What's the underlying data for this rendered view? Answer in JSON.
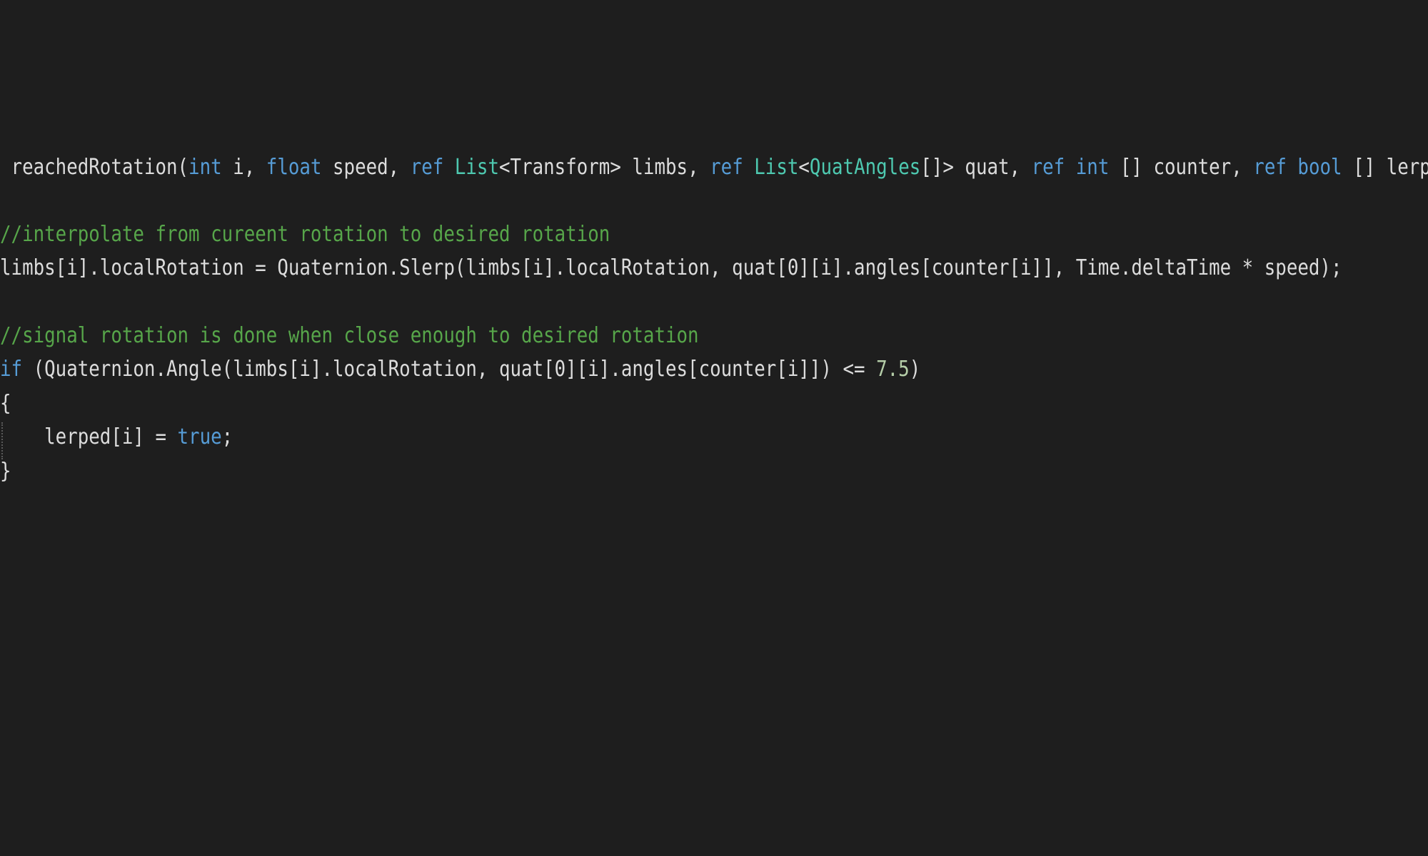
{
  "colors": {
    "background": "#1e1e1e",
    "plain": "#dcdcdc",
    "keyword": "#569cd6",
    "type": "#4ec9b0",
    "comment": "#57a64a",
    "number": "#b5cea8"
  },
  "editor": {
    "lines": [
      {
        "tokens": [
          {
            "text": " reachedRotation(",
            "kind": "plain"
          },
          {
            "text": "int",
            "kind": "keyword"
          },
          {
            "text": " i, ",
            "kind": "plain"
          },
          {
            "text": "float",
            "kind": "keyword"
          },
          {
            "text": " speed, ",
            "kind": "plain"
          },
          {
            "text": "ref",
            "kind": "keyword"
          },
          {
            "text": " ",
            "kind": "plain"
          },
          {
            "text": "List",
            "kind": "type"
          },
          {
            "text": "<Transform> limbs, ",
            "kind": "plain"
          },
          {
            "text": "ref",
            "kind": "keyword"
          },
          {
            "text": " ",
            "kind": "plain"
          },
          {
            "text": "List",
            "kind": "type"
          },
          {
            "text": "<",
            "kind": "plain"
          },
          {
            "text": "QuatAngles",
            "kind": "type"
          },
          {
            "text": "[]> quat, ",
            "kind": "plain"
          },
          {
            "text": "ref",
            "kind": "keyword"
          },
          {
            "text": " ",
            "kind": "plain"
          },
          {
            "text": "int",
            "kind": "keyword"
          },
          {
            "text": " [] counter, ",
            "kind": "plain"
          },
          {
            "text": "ref",
            "kind": "keyword"
          },
          {
            "text": " ",
            "kind": "plain"
          },
          {
            "text": "bool",
            "kind": "keyword"
          },
          {
            "text": " [] lerpe",
            "kind": "plain"
          }
        ]
      },
      {
        "tokens": [
          {
            "text": "//interpolate from cureent rotation to desired rotation",
            "kind": "comment"
          }
        ]
      },
      {
        "tokens": [
          {
            "text": "limbs[i].localRotation = Quaternion.Slerp(limbs[i].localRotation, quat[0][i].angles[counter[i]], Time.deltaTime * speed);",
            "kind": "plain"
          }
        ]
      },
      {
        "tokens": [
          {
            "text": "//signal rotation is done when close enough to desired rotation",
            "kind": "comment"
          }
        ]
      },
      {
        "tokens": [
          {
            "text": "if",
            "kind": "keyword"
          },
          {
            "text": " (Quaternion.Angle(limbs[i].localRotation, quat[0][i].angles[counter[i]]) <= ",
            "kind": "plain"
          },
          {
            "text": "7.5",
            "kind": "number"
          },
          {
            "text": ")",
            "kind": "plain"
          }
        ]
      },
      {
        "tokens": [
          {
            "text": "{",
            "kind": "plain"
          }
        ]
      },
      {
        "tokens": [
          {
            "text": "    lerped[i] = ",
            "kind": "plain"
          },
          {
            "text": "true",
            "kind": "keyword"
          },
          {
            "text": ";",
            "kind": "plain"
          }
        ]
      },
      {
        "tokens": [
          {
            "text": "}",
            "kind": "plain"
          }
        ]
      }
    ]
  }
}
